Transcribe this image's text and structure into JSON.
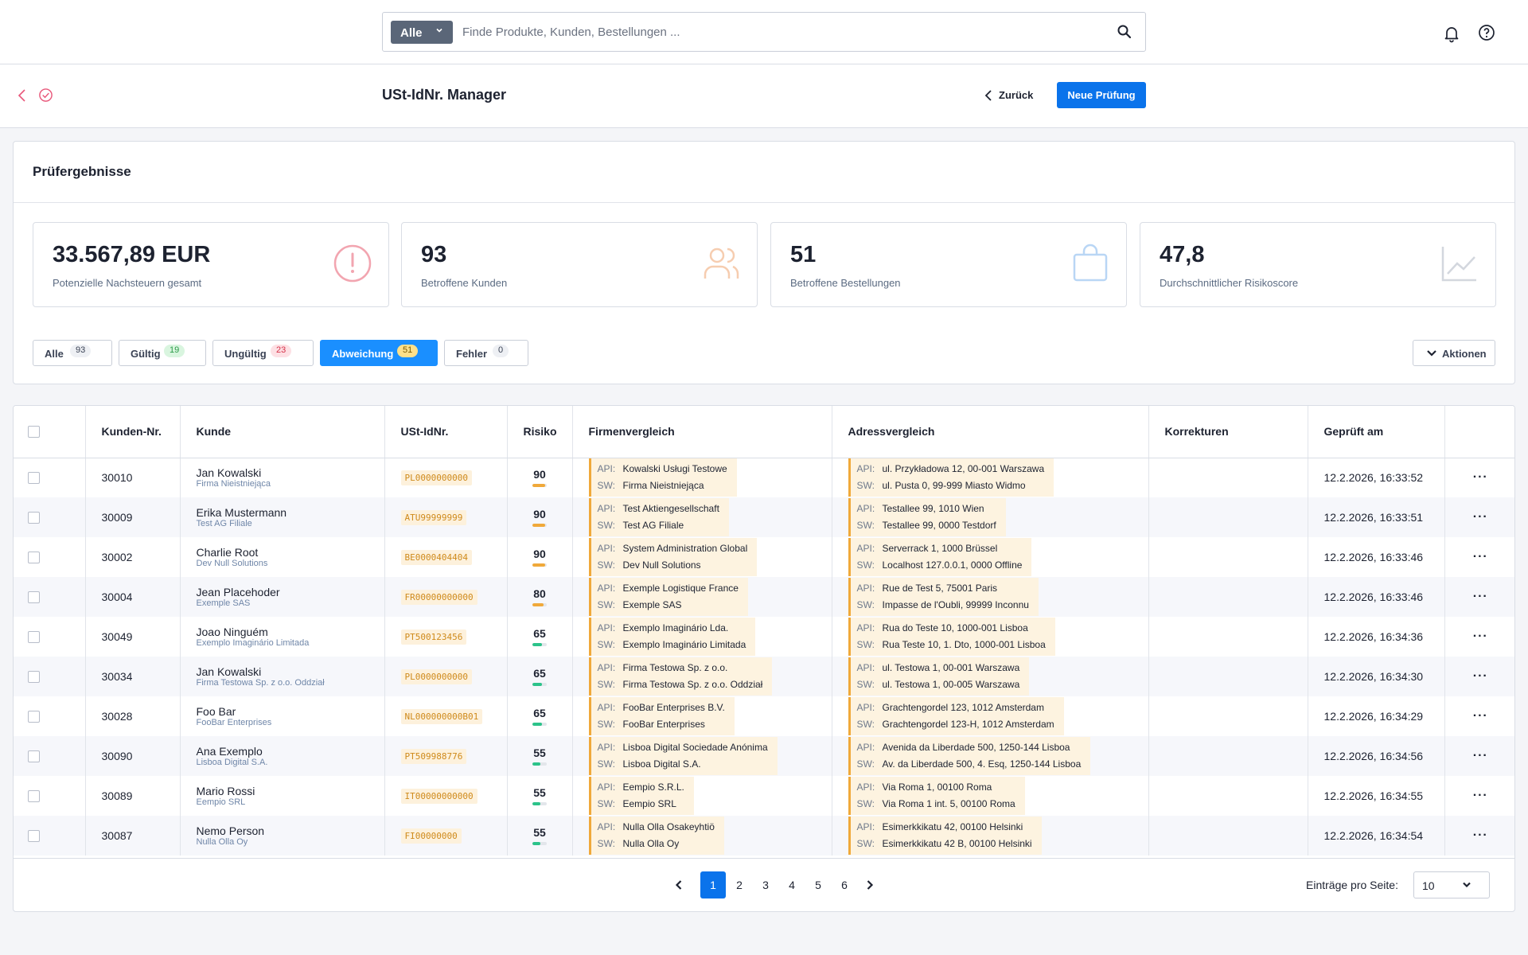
{
  "search": {
    "scope": "Alle",
    "placeholder": "Finde Produkte, Kunden, Bestellungen ..."
  },
  "header": {
    "title": "USt-IdNr. Manager",
    "back_label": "Zurück",
    "primary_label": "Neue Prüfung"
  },
  "results": {
    "title": "Prüfergebnisse"
  },
  "kpis": [
    {
      "value": "33.567,89 EUR",
      "label": "Potenzielle Nachsteuern gesamt",
      "icon": "alert-circle-icon",
      "color": "#f2a5b0"
    },
    {
      "value": "93",
      "label": "Betroffene Kunden",
      "icon": "users-icon",
      "color": "#f6cdb0"
    },
    {
      "value": "51",
      "label": "Betroffene Bestellungen",
      "icon": "shopping-bag-icon",
      "color": "#b9d6f5"
    },
    {
      "value": "47,8",
      "label": "Durchschnittlicher Risikoscore",
      "icon": "line-chart-icon",
      "color": "#d3d7de"
    }
  ],
  "filters": [
    {
      "label": "Alle",
      "count": "93",
      "badge_bg": "#eef0f4",
      "badge_fg": "#3a4254"
    },
    {
      "label": "Gültig",
      "count": "19",
      "badge_bg": "#d9f5df",
      "badge_fg": "#2d9c4a"
    },
    {
      "label": "Ungültig",
      "count": "23",
      "badge_bg": "#fde0e4",
      "badge_fg": "#d6324a"
    },
    {
      "label": "Abweichung",
      "count": "51",
      "badge_bg": "#ffe08a",
      "badge_fg": "#7a5a00"
    },
    {
      "label": "Fehler",
      "count": "0",
      "badge_bg": "#eef0f4",
      "badge_fg": "#3a4254"
    }
  ],
  "actions_label": "Aktionen",
  "table": {
    "columns": [
      "Kunden-Nr.",
      "Kunde",
      "USt-IdNr.",
      "Risiko",
      "Firmenvergleich",
      "Adressvergleich",
      "Korrekturen",
      "Geprüft am"
    ],
    "api_key": "API:",
    "sw_key": "SW:",
    "rows": [
      {
        "nr": "30010",
        "name": "Jan Kowalski",
        "company": "Firma Nieistniejąca",
        "vat": "PL0000000000",
        "risk": "90",
        "risk_pct": 0.9,
        "risk_color": "#f0a93a",
        "firm_api": "Kowalski Usługi Testowe",
        "firm_sw": "Firma Nieistniejąca",
        "addr_api": "ul. Przykładowa 12, 00-001 Warszawa",
        "addr_sw": "ul. Pusta 0, 99-999 Miasto Widmo",
        "date": "12.2.2026, 16:33:52"
      },
      {
        "nr": "30009",
        "name": "Erika Mustermann",
        "company": "Test AG Filiale",
        "vat": "ATU99999999",
        "risk": "90",
        "risk_pct": 0.9,
        "risk_color": "#f0a93a",
        "firm_api": "Test Aktiengesellschaft",
        "firm_sw": "Test AG Filiale",
        "addr_api": "Testallee 99, 1010 Wien",
        "addr_sw": "Testallee 99, 0000 Testdorf",
        "date": "12.2.2026, 16:33:51"
      },
      {
        "nr": "30002",
        "name": "Charlie Root",
        "company": "Dev Null Solutions",
        "vat": "BE0000404404",
        "risk": "90",
        "risk_pct": 0.9,
        "risk_color": "#f0a93a",
        "firm_api": "System Administration Global",
        "firm_sw": "Dev Null Solutions",
        "addr_api": "Serverrack 1, 1000 Brüssel",
        "addr_sw": "Localhost 127.0.0.1, 0000 Offline",
        "date": "12.2.2026, 16:33:46"
      },
      {
        "nr": "30004",
        "name": "Jean Placehoder",
        "company": "Exemple SAS",
        "vat": "FR00000000000",
        "risk": "80",
        "risk_pct": 0.8,
        "risk_color": "#f0a93a",
        "firm_api": "Exemple Logistique France",
        "firm_sw": "Exemple SAS",
        "addr_api": "Rue de Test 5, 75001 Paris",
        "addr_sw": "Impasse de l'Oubli, 99999 Inconnu",
        "date": "12.2.2026, 16:33:46"
      },
      {
        "nr": "30049",
        "name": "Joao Ninguém",
        "company": "Exemplo Imaginário Limitada",
        "vat": "PT500123456",
        "risk": "65",
        "risk_pct": 0.65,
        "risk_color": "#2cc38a",
        "firm_api": "Exemplo Imaginário Lda.",
        "firm_sw": "Exemplo Imaginário Limitada",
        "addr_api": "Rua do Teste 10, 1000-001 Lisboa",
        "addr_sw": "Rua Teste 10, 1. Dto, 1000-001 Lisboa",
        "date": "12.2.2026, 16:34:36"
      },
      {
        "nr": "30034",
        "name": "Jan Kowalski",
        "company": "Firma Testowa Sp. z o.o. Oddział",
        "vat": "PL0000000000",
        "risk": "65",
        "risk_pct": 0.65,
        "risk_color": "#2cc38a",
        "firm_api": "Firma Testowa Sp. z o.o.",
        "firm_sw": "Firma Testowa Sp. z o.o. Oddział",
        "addr_api": "ul. Testowa 1, 00-001 Warszawa",
        "addr_sw": "ul. Testowa 1, 00-005 Warszawa",
        "date": "12.2.2026, 16:34:30"
      },
      {
        "nr": "30028",
        "name": "Foo Bar",
        "company": "FooBar Enterprises",
        "vat": "NL000000000B01",
        "risk": "65",
        "risk_pct": 0.65,
        "risk_color": "#2cc38a",
        "firm_api": "FooBar Enterprises B.V.",
        "firm_sw": "FooBar Enterprises",
        "addr_api": "Grachtengordel 123, 1012 Amsterdam",
        "addr_sw": "Grachtengordel 123-H, 1012 Amsterdam",
        "date": "12.2.2026, 16:34:29"
      },
      {
        "nr": "30090",
        "name": "Ana Exemplo",
        "company": "Lisboa Digital S.A.",
        "vat": "PT509988776",
        "risk": "55",
        "risk_pct": 0.55,
        "risk_color": "#2cc38a",
        "firm_api": "Lisboa Digital Sociedade Anónima",
        "firm_sw": "Lisboa Digital S.A.",
        "addr_api": "Avenida da Liberdade 500, 1250-144 Lisboa",
        "addr_sw": "Av. da Liberdade 500, 4. Esq, 1250-144 Lisboa",
        "date": "12.2.2026, 16:34:56"
      },
      {
        "nr": "30089",
        "name": "Mario Rossi",
        "company": "Eempio SRL",
        "vat": "IT00000000000",
        "risk": "55",
        "risk_pct": 0.55,
        "risk_color": "#2cc38a",
        "firm_api": "Eempio S.R.L.",
        "firm_sw": "Eempio SRL",
        "addr_api": "Via Roma 1, 00100 Roma",
        "addr_sw": "Via Roma 1 int. 5, 00100 Roma",
        "date": "12.2.2026, 16:34:55"
      },
      {
        "nr": "30087",
        "name": "Nemo Person",
        "company": "Nulla Olla Oy",
        "vat": "FI00000000",
        "risk": "55",
        "risk_pct": 0.55,
        "risk_color": "#2cc38a",
        "firm_api": "Nulla Olla Osakeyhtiö",
        "firm_sw": "Nulla Olla Oy",
        "addr_api": "Esimerkkikatu 42, 00100 Helsinki",
        "addr_sw": "Esimerkkikatu 42 B, 00100 Helsinki",
        "date": "12.2.2026, 16:34:54"
      }
    ]
  },
  "pagination": {
    "pages": [
      "1",
      "2",
      "3",
      "4",
      "5",
      "6"
    ],
    "current": "1",
    "per_page_label": "Einträge pro Seite:",
    "per_page_value": "10"
  },
  "colors": {
    "primary": "#0a73eb",
    "active_filter": "#1a8fff",
    "mismatch": "#f0a93a"
  }
}
